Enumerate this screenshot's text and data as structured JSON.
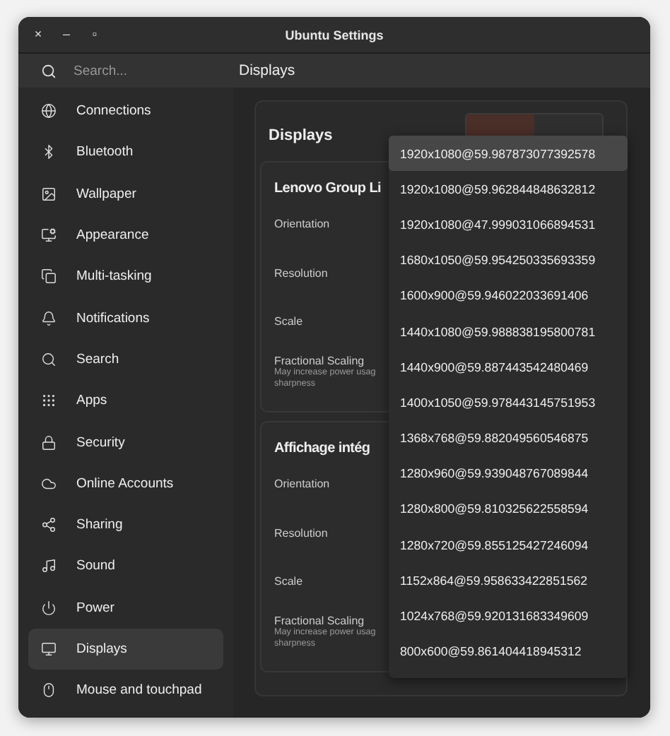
{
  "window": {
    "title": "Ubuntu Settings",
    "controls": [
      "×",
      "–",
      "▫"
    ]
  },
  "search": {
    "placeholder": "Search..."
  },
  "page_title": "Displays",
  "sidebar": {
    "items": [
      {
        "label": "Connections",
        "selected": false
      },
      {
        "label": "Bluetooth",
        "selected": false
      },
      {
        "label": "Wallpaper",
        "selected": false
      },
      {
        "label": "Appearance",
        "selected": false
      },
      {
        "label": "Multi-tasking",
        "selected": false
      },
      {
        "label": "Notifications",
        "selected": false
      },
      {
        "label": "Search",
        "selected": false
      },
      {
        "label": "Apps",
        "selected": false
      },
      {
        "label": "Security",
        "selected": false
      },
      {
        "label": "Online Accounts",
        "selected": false
      },
      {
        "label": "Sharing",
        "selected": false
      },
      {
        "label": "Sound",
        "selected": false
      },
      {
        "label": "Power",
        "selected": false
      },
      {
        "label": "Displays",
        "selected": true
      },
      {
        "label": "Mouse and touchpad",
        "selected": false
      }
    ]
  },
  "panel": {
    "title": "Displays",
    "monitors": [
      {
        "name": "Lenovo Group Li",
        "rows": [
          {
            "label": "Orientation"
          },
          {
            "label": "Resolution"
          },
          {
            "label": "Scale"
          },
          {
            "label": "Fractional Scaling",
            "hint": [
              "May increase power usag",
              "sharpness"
            ]
          }
        ]
      },
      {
        "name": "Affichage intég",
        "rows": [
          {
            "label": "Orientation"
          },
          {
            "label": "Resolution"
          },
          {
            "label": "Scale"
          },
          {
            "label": "Fractional Scaling",
            "hint": [
              "May increase power usag",
              "sharpness"
            ]
          }
        ]
      }
    ]
  },
  "mode_menu": {
    "items": [
      {
        "label": "1920x1080@59.987873077392578",
        "selected": true
      },
      {
        "label": "1920x1080@59.962844848632812",
        "selected": false
      },
      {
        "label": "1920x1080@47.999031066894531",
        "selected": false
      },
      {
        "label": "1680x1050@59.954250335693359",
        "selected": false
      },
      {
        "label": "1600x900@59.946022033691406",
        "selected": false
      },
      {
        "label": "1440x1080@59.988838195800781",
        "selected": false
      },
      {
        "label": "1440x900@59.887443542480469",
        "selected": false
      },
      {
        "label": "1400x1050@59.978443145751953",
        "selected": false
      },
      {
        "label": "1368x768@59.882049560546875",
        "selected": false
      },
      {
        "label": "1280x960@59.939048767089844",
        "selected": false
      },
      {
        "label": "1280x800@59.810325622558594",
        "selected": false
      },
      {
        "label": "1280x720@59.855125427246094",
        "selected": false
      },
      {
        "label": "1152x864@59.958633422851562",
        "selected": false
      },
      {
        "label": "1024x768@59.920131683349609",
        "selected": false
      },
      {
        "label": "800x600@59.861404418945312",
        "selected": false
      }
    ]
  }
}
